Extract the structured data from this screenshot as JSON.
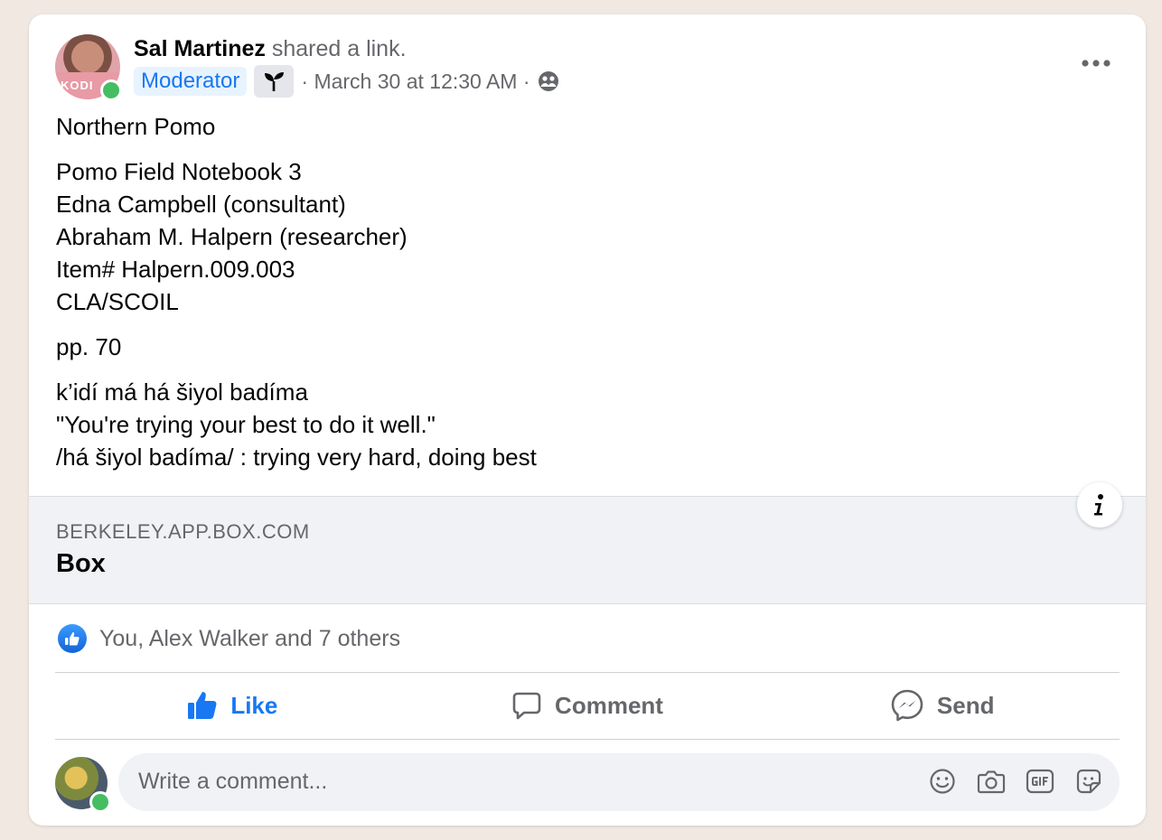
{
  "post": {
    "author_name": "Sal Martinez",
    "author_action": "shared a link.",
    "badge": "Moderator",
    "meta": "· March 30 at 12:30 AM ·",
    "avatar_text": "KODI",
    "icons": {
      "more": "more-options-icon",
      "badge": "sprout-icon",
      "audience": "group-audience-icon"
    },
    "body": {
      "paragraph1": "Northern Pomo",
      "paragraph2": [
        "Pomo Field Notebook 3",
        "Edna Campbell (consultant)",
        "Abraham M. Halpern (researcher)",
        "Item# Halpern.009.003",
        "CLA/SCOIL"
      ],
      "paragraph3": "pp. 70",
      "paragraph4": [
        "k’idí má há šiyol badíma",
        "\"You're trying your best to do it well.\"",
        "/há šiyol badíma/ : trying very hard, doing best"
      ]
    }
  },
  "link_preview": {
    "domain": "BERKELEY.APP.BOX.COM",
    "title": "Box",
    "info_icon": "info-icon"
  },
  "reactions": {
    "text": "You, Alex Walker and 7 others",
    "icon": "like-reaction-icon"
  },
  "actions": {
    "like": "Like",
    "comment": "Comment",
    "send": "Send"
  },
  "comment_box": {
    "placeholder": "Write a comment...",
    "tools": [
      "emoji-icon",
      "camera-icon",
      "gif-icon",
      "sticker-icon"
    ]
  },
  "colors": {
    "accent": "#1877f2",
    "secondary_text": "#65676b",
    "online": "#45bd62",
    "page_background": "#f1e8e2"
  }
}
